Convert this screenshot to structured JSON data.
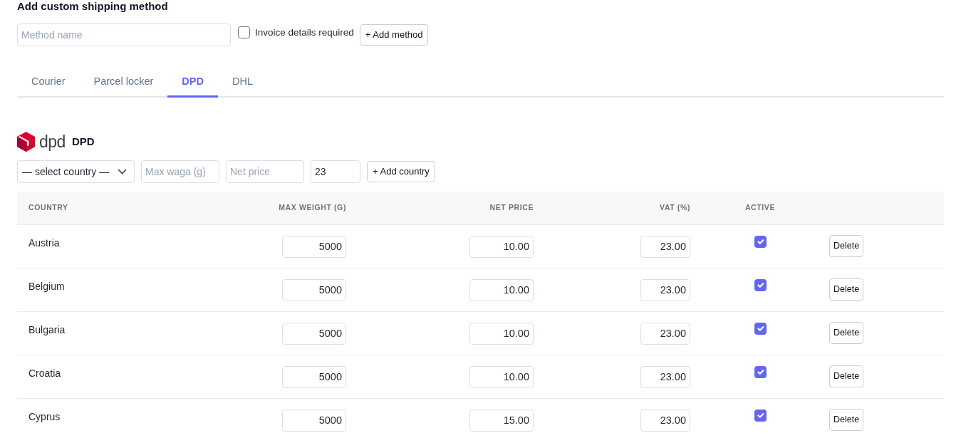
{
  "title": "Add custom shipping method",
  "new_method": {
    "name_field": {
      "placeholder": "Method name"
    },
    "invoice_required": {
      "label": "Invoice details required",
      "checked": false
    },
    "add_button": "+ Add method"
  },
  "tabs": [
    {
      "label": "Courier",
      "selected": false
    },
    {
      "label": "Parcel locker",
      "selected": false
    },
    {
      "label": "DPD",
      "selected": true
    },
    {
      "label": "DHL",
      "selected": false
    }
  ],
  "carrier": {
    "logo_text": "dpd",
    "name": "DPD"
  },
  "add_country": {
    "country_select": {
      "value": "— select country —"
    },
    "max_weight_field": {
      "placeholder": "Max waga (g)"
    },
    "net_price_field": {
      "placeholder": "Net price"
    },
    "vat_field": {
      "value": "23"
    },
    "add_button": "+ Add country"
  },
  "table": {
    "columns": [
      "COUNTRY",
      "MAX WEIGHT (G)",
      "NET PRICE",
      "VAT (%)",
      "ACTIVE"
    ],
    "rows": [
      {
        "country": "Austria",
        "max_weight": "5000",
        "net_price": "10.00",
        "vat": "23.00",
        "active": true,
        "delete": "Delete"
      },
      {
        "country": "Belgium",
        "max_weight": "5000",
        "net_price": "10.00",
        "vat": "23.00",
        "active": true,
        "delete": "Delete"
      },
      {
        "country": "Bulgaria",
        "max_weight": "5000",
        "net_price": "10.00",
        "vat": "23.00",
        "active": true,
        "delete": "Delete"
      },
      {
        "country": "Croatia",
        "max_weight": "5000",
        "net_price": "10.00",
        "vat": "23.00",
        "active": true,
        "delete": "Delete"
      },
      {
        "country": "Cyprus",
        "max_weight": "5000",
        "net_price": "15.00",
        "vat": "23.00",
        "active": true,
        "delete": "Delete"
      }
    ]
  }
}
